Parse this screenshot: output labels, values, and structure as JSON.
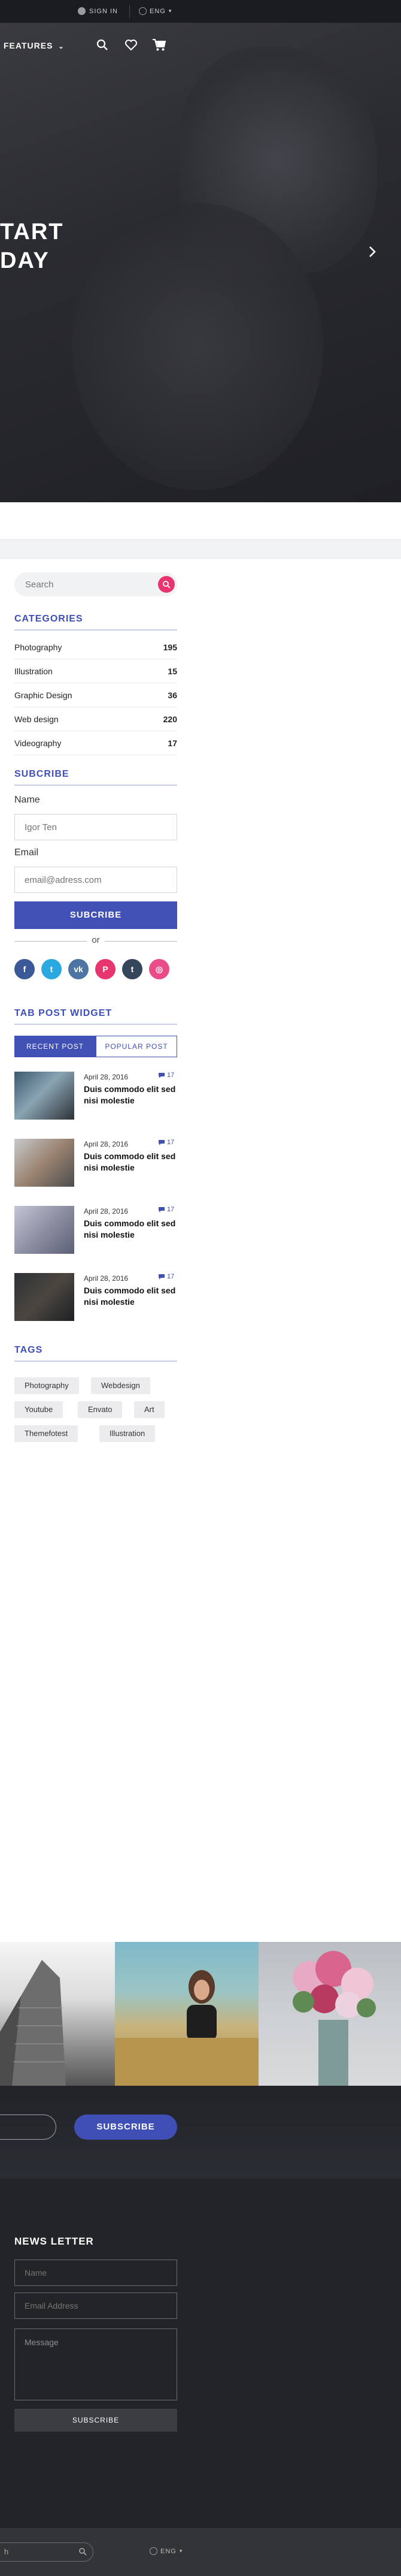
{
  "topbar": {
    "sign_in": "SIGN IN",
    "language": "ENG"
  },
  "nav": {
    "features": "FEATURES"
  },
  "hero": {
    "line1": "TART",
    "line2": "DAY"
  },
  "search": {
    "placeholder": "Search"
  },
  "categories": {
    "title": "CATEGORIES",
    "items": [
      {
        "name": "Photography",
        "count": "195"
      },
      {
        "name": "Illustration",
        "count": "15"
      },
      {
        "name": "Graphic Design",
        "count": "36"
      },
      {
        "name": "Web design",
        "count": "220"
      },
      {
        "name": "Videography",
        "count": "17"
      }
    ]
  },
  "subscribe": {
    "title": "SUBCRIBE",
    "name_label": "Name",
    "name_placeholder": "Igor Ten",
    "email_label": "Email",
    "email_placeholder": "email@adress.com",
    "button": "SUBCRIBE",
    "or": "or",
    "social": [
      {
        "icon": "facebook-icon",
        "glyph": "f",
        "color": "#3b5998"
      },
      {
        "icon": "twitter-icon",
        "glyph": "t",
        "color": "#2aa9e0"
      },
      {
        "icon": "vk-icon",
        "glyph": "vk",
        "color": "#4c75a3"
      },
      {
        "icon": "pinterest-icon",
        "glyph": "P",
        "color": "#e8356e"
      },
      {
        "icon": "tumblr-icon",
        "glyph": "t",
        "color": "#35465c"
      },
      {
        "icon": "dribbble-icon",
        "glyph": "◎",
        "color": "#ea4c89"
      }
    ]
  },
  "tab_widget": {
    "title": "TAB POST WIDGET",
    "tab_recent": "RECENT POST",
    "tab_popular": "POPULAR POST",
    "posts": [
      {
        "date": "April 28, 2016",
        "comments": "17",
        "title": "Duis commodo elit sed nisi molestie"
      },
      {
        "date": "April 28, 2016",
        "comments": "17",
        "title": "Duis commodo elit sed nisi molestie"
      },
      {
        "date": "April 28, 2016",
        "comments": "17",
        "title": "Duis commodo elit sed nisi molestie"
      },
      {
        "date": "April 28, 2016",
        "comments": "17",
        "title": "Duis commodo elit sed nisi molestie"
      }
    ]
  },
  "tags": {
    "title": "TAGS",
    "items": [
      "Photography",
      "Webdesign",
      "Youtube",
      "Envato",
      "Art",
      "Themefotest",
      "Illustration"
    ]
  },
  "band": {
    "button": "SUBSCRIBE"
  },
  "newsletter": {
    "title": "NEWS LETTER",
    "name_placeholder": "Name",
    "email_placeholder": "Email Address",
    "message_placeholder": "Message",
    "button": "SUBSCRIBE"
  },
  "bottom": {
    "search_text": "h",
    "language": "ENG"
  },
  "colors": {
    "accent": "#4150b5",
    "pink": "#e8356e"
  }
}
